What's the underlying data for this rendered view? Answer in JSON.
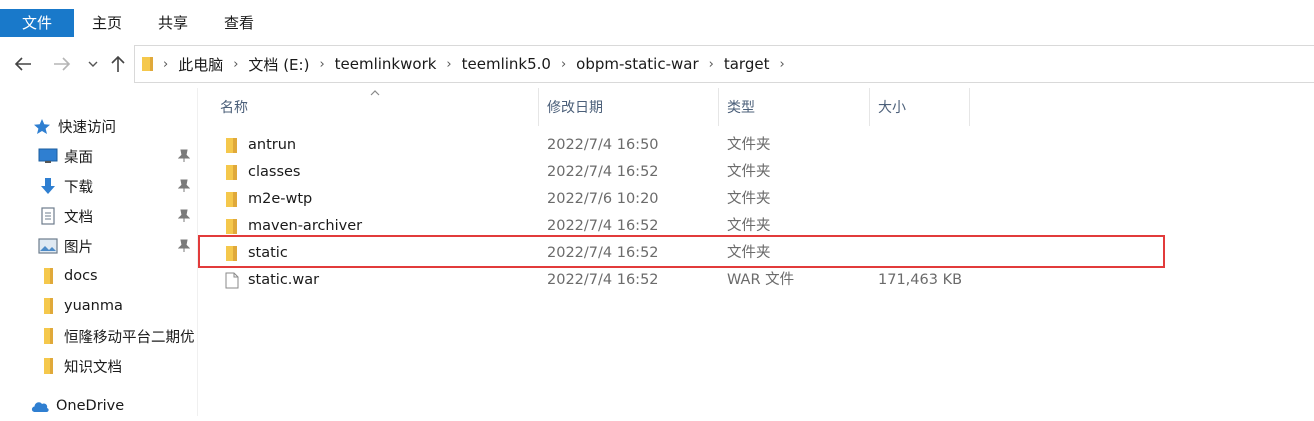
{
  "ribbon": {
    "tabs": [
      "文件",
      "主页",
      "共享",
      "查看"
    ]
  },
  "nav": {
    "back_icon": "arrow-left-icon",
    "forward_icon": "arrow-right-icon",
    "recent_icon": "chevron-down-icon",
    "up_icon": "arrow-up-icon"
  },
  "breadcrumb": [
    "此电脑",
    "文档 (E:)",
    "teemlinkwork",
    "teemlink5.0",
    "obpm-static-war",
    "target"
  ],
  "sidebar": {
    "items": [
      {
        "label": "快速访问",
        "icon": "star-icon",
        "pinned": false
      },
      {
        "label": "桌面",
        "icon": "desktop-icon",
        "pinned": true
      },
      {
        "label": "下载",
        "icon": "download-icon",
        "pinned": true
      },
      {
        "label": "文档",
        "icon": "document-icon",
        "pinned": true
      },
      {
        "label": "图片",
        "icon": "picture-icon",
        "pinned": true
      },
      {
        "label": "docs",
        "icon": "folder-icon",
        "pinned": false
      },
      {
        "label": "yuanma",
        "icon": "folder-icon",
        "pinned": false
      },
      {
        "label": "恒隆移动平台二期优",
        "icon": "folder-icon",
        "pinned": false
      },
      {
        "label": "知识文档",
        "icon": "folder-icon",
        "pinned": false
      },
      {
        "label": "OneDrive",
        "icon": "cloud-icon",
        "pinned": false
      }
    ]
  },
  "columns": {
    "name": "名称",
    "date": "修改日期",
    "type": "类型",
    "size": "大小"
  },
  "files": [
    {
      "name": "antrun",
      "date": "2022/7/4 16:50",
      "type": "文件夹",
      "size": "",
      "icon": "folder-icon"
    },
    {
      "name": "classes",
      "date": "2022/7/4 16:52",
      "type": "文件夹",
      "size": "",
      "icon": "folder-icon"
    },
    {
      "name": "m2e-wtp",
      "date": "2022/7/6 10:20",
      "type": "文件夹",
      "size": "",
      "icon": "folder-icon"
    },
    {
      "name": "maven-archiver",
      "date": "2022/7/4 16:52",
      "type": "文件夹",
      "size": "",
      "icon": "folder-icon"
    },
    {
      "name": "static",
      "date": "2022/7/4 16:52",
      "type": "文件夹",
      "size": "",
      "icon": "folder-icon"
    },
    {
      "name": "static.war",
      "date": "2022/7/4 16:52",
      "type": "WAR 文件",
      "size": "171,463 KB",
      "icon": "file-icon"
    }
  ],
  "colors": {
    "file_tab": "#1979ca",
    "highlight_border": "#e23b3b",
    "folder": "#f5c84c"
  }
}
